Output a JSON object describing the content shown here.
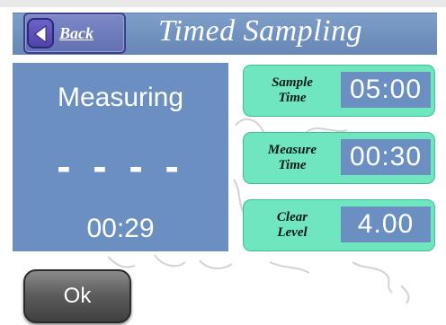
{
  "header": {
    "back_label": "Back",
    "title": "Timed Sampling"
  },
  "status": {
    "label": "Measuring",
    "value": "- - - -",
    "time": "00:29"
  },
  "params": [
    {
      "label_line1": "Sample",
      "label_line2": "Time",
      "value": "05:00"
    },
    {
      "label_line1": "Measure",
      "label_line2": "Time",
      "value": "00:30"
    },
    {
      "label_line1": "Clear",
      "label_line2": "Level",
      "value": "4.00"
    }
  ],
  "footer": {
    "ok_label": "Ok"
  },
  "colors": {
    "header_blue": "#6f8fbd",
    "panel_blue": "#6a8fc0",
    "param_green": "#6fe6c0",
    "back_purple": "#6270b3"
  }
}
